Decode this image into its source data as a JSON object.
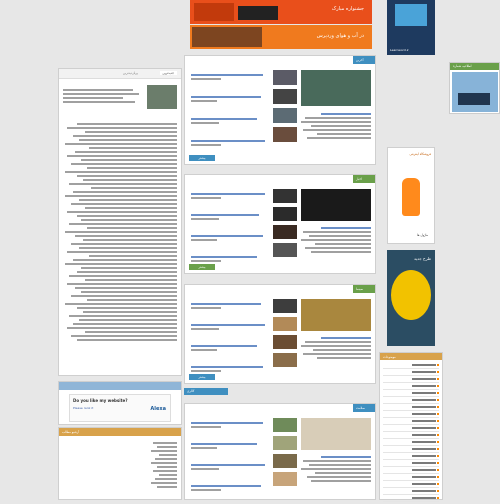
{
  "banners": {
    "top1": "جشنواره مبارک",
    "top2": "جشنواره تابستانه",
    "top3": "در آب و هوای وردپرس",
    "logo": "Learnword.ir"
  },
  "right_ad": {
    "title": "اطلاعیه شماره"
  },
  "left_promo": {
    "question": "Do you like my website?",
    "sub": "Please rank it",
    "brand": "Alexa"
  },
  "orange_ad": {
    "title": "فروشگاه اینترنتی",
    "bottom": "ماژول ها"
  },
  "tall_ad": {
    "title": "طرح جدید"
  },
  "sections": [
    {
      "name": "tab-latest",
      "title": "آخرین مطالب"
    },
    {
      "name": "tab-news",
      "title": "اخبار"
    },
    {
      "name": "tab-cinema",
      "title": "سینما"
    },
    {
      "name": "tab-gallery",
      "title": "گالری"
    },
    {
      "name": "tab-health",
      "title": "سلامت"
    }
  ],
  "more_buttons": [
    "بیشتر",
    "بیشتر",
    "بیشتر",
    "بیشتر"
  ],
  "left_tabs": [
    "جدیدترین",
    "پربازدیدترین"
  ],
  "left_bottom_title": "آرشیو مطالب",
  "right_sidebar_title": "موضوعات",
  "colors": {
    "blue": "#3f8fc0",
    "green": "#6aa04a",
    "orange": "#d8a24b",
    "link": "#3a5fa8"
  }
}
